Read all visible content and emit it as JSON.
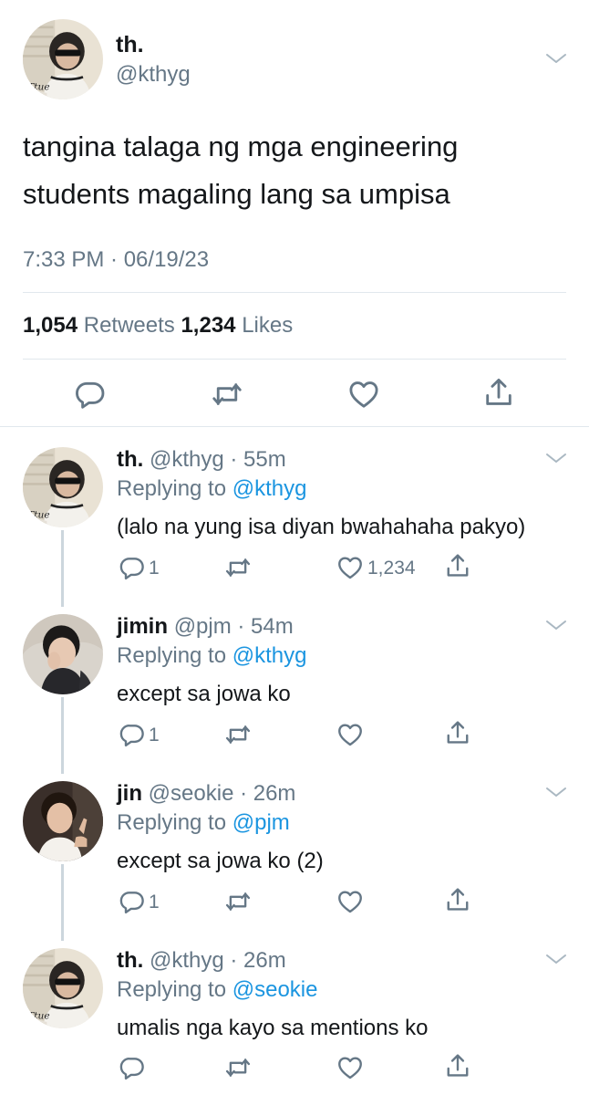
{
  "main_tweet": {
    "display_name": "th.",
    "handle": "@kthyg",
    "text_line1": "tangina talaga ng mga engineering",
    "text_line2": "students magaling lang sa umpisa",
    "timestamp": "7:33 PM · 06/19/23",
    "retweets_count": "1,054",
    "retweets_label": "Retweets",
    "likes_count": "1,234",
    "likes_label": "Likes"
  },
  "replies": [
    {
      "display_name": "th.",
      "meta": "@kthyg · 55m",
      "replying_prefix": "Replying to",
      "replying_handle": "@kthyg",
      "text": "(lalo na yung isa diyan bwahahaha pakyo)",
      "reply_count": "1",
      "like_count": "1,234"
    },
    {
      "display_name": "jimin",
      "meta": "@pjm · 54m",
      "replying_prefix": "Replying to",
      "replying_handle": "@kthyg",
      "text": "except sa jowa ko",
      "reply_count": "1",
      "like_count": ""
    },
    {
      "display_name": "jin",
      "meta": "@seokie · 26m",
      "replying_prefix": "Replying to",
      "replying_handle": "@pjm",
      "text": "except sa jowa ko (2)",
      "reply_count": "1",
      "like_count": ""
    },
    {
      "display_name": "th.",
      "meta": "@kthyg · 26m",
      "replying_prefix": "Replying to",
      "replying_handle": "@seokie",
      "text": "umalis nga kayo sa mentions ko",
      "reply_count": "",
      "like_count": ""
    }
  ],
  "colors": {
    "link_blue": "#1b95e0",
    "secondary_grey": "#657786",
    "divider": "#e1e8ed",
    "thread_line": "#ccd6dd"
  },
  "icons": [
    "reply-icon",
    "retweet-icon",
    "like-icon",
    "share-icon",
    "chevron-down-icon"
  ]
}
